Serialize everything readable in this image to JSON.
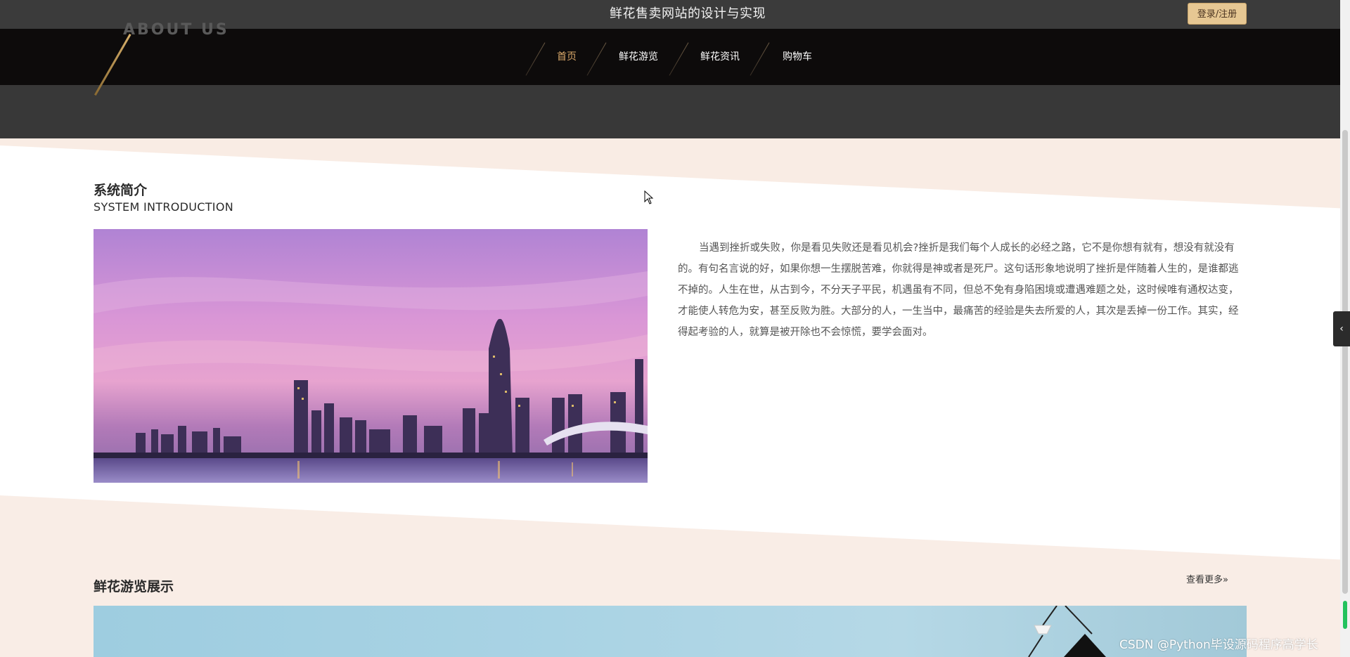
{
  "header": {
    "title": "鲜花售卖网站的设计与实现",
    "login_label": "登录/注册"
  },
  "nav": {
    "items": [
      {
        "label": "首页",
        "active": true
      },
      {
        "label": "鲜花游览",
        "active": false
      },
      {
        "label": "鲜花资讯",
        "active": false
      },
      {
        "label": "购物车",
        "active": false
      }
    ]
  },
  "banner": {
    "ghost_text": "ABOUT US"
  },
  "intro": {
    "title_cn": "系统简介",
    "title_en": "SYSTEM INTRODUCTION",
    "paragraph": "当遇到挫折或失败，你是看见失败还是看见机会?挫折是我们每个人成长的必经之路，它不是你想有就有，想没有就没有的。有句名言说的好，如果你想一生摆脱苦难，你就得是神或者是死尸。这句话形象地说明了挫折是伴随着人生的，是谁都逃不掉的。人生在世，从古到今，不分天子平民，机遇虽有不同，但总不免有身陷困境或遭遇难题之处，这时候唯有通权达变，才能使人转危为安，甚至反败为胜。大部分的人，一生当中，最痛苦的经验是失去所爱的人，其次是丢掉一份工作。其实，经得起考验的人，就算是被开除也不会惊慌，要学会面对。"
  },
  "flowers": {
    "title": "鲜花游览展示",
    "more_label": "查看更多"
  },
  "side_tab": {
    "icon": "chevron-left-icon"
  },
  "watermark": "CSDN @Python毕设源码程序高学长",
  "colors": {
    "topbar": "#3b3b3b",
    "navbar": "#0d0b0b",
    "accent_gold": "#e6c793",
    "active_nav": "#d9a86a",
    "peach": "#f9ece4"
  }
}
